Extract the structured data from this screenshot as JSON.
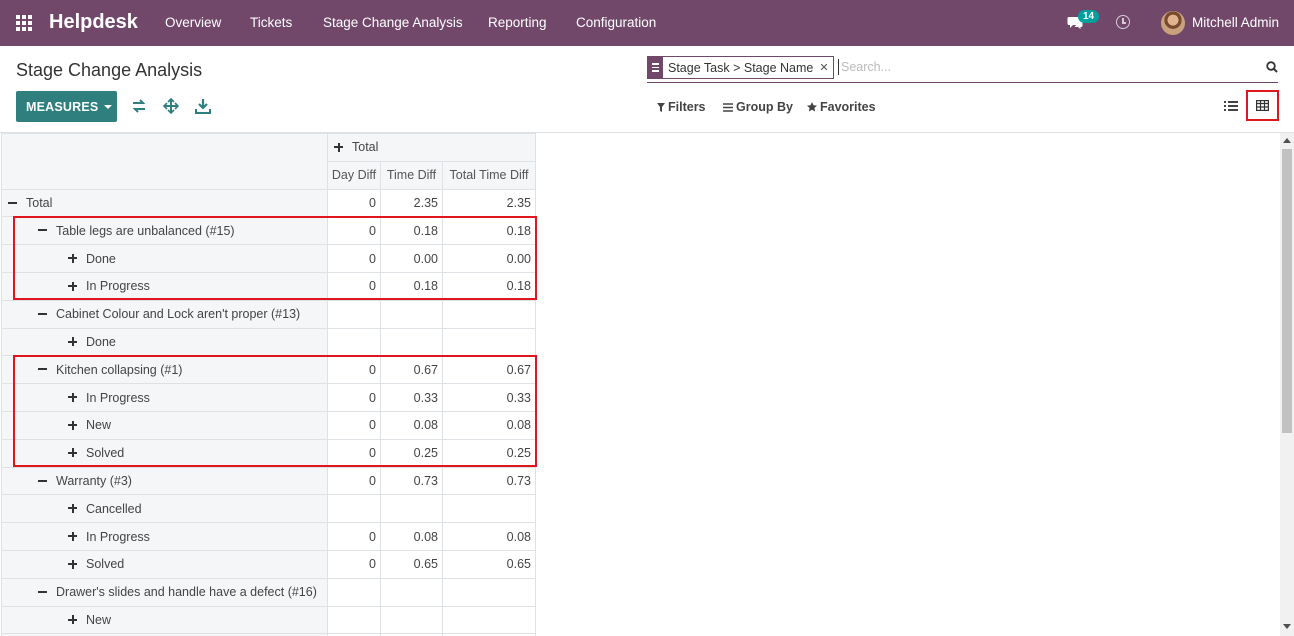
{
  "nav": {
    "brand": "Helpdesk",
    "menu": [
      "Overview",
      "Tickets",
      "Stage Change Analysis",
      "Reporting",
      "Configuration"
    ],
    "chat_badge": "14",
    "user": "Mitchell Admin"
  },
  "control": {
    "title": "Stage Change Analysis",
    "measures_label": "MEASURES",
    "facet_label": "Stage Task > Stage Name",
    "search_placeholder": "Search...",
    "filters_label": "Filters",
    "groupby_label": "Group By",
    "favorites_label": "Favorites"
  },
  "pivot": {
    "col_total": "Total",
    "measures": [
      "Day Diff",
      "Time Diff",
      "Total Time Diff"
    ],
    "rows": [
      {
        "label": "Total",
        "level": 0,
        "icon": "minus",
        "v": [
          "0",
          "2.35",
          "2.35"
        ]
      },
      {
        "label": "Table legs are unbalanced (#15)",
        "level": 1,
        "icon": "minus",
        "v": [
          "0",
          "0.18",
          "0.18"
        ]
      },
      {
        "label": "Done",
        "level": 2,
        "icon": "plus",
        "v": [
          "0",
          "0.00",
          "0.00"
        ]
      },
      {
        "label": "In Progress",
        "level": 2,
        "icon": "plus",
        "v": [
          "0",
          "0.18",
          "0.18"
        ]
      },
      {
        "label": "Cabinet Colour and Lock aren't proper (#13)",
        "level": 1,
        "icon": "minus",
        "v": [
          "",
          "",
          ""
        ]
      },
      {
        "label": "Done",
        "level": 2,
        "icon": "plus",
        "v": [
          "",
          "",
          ""
        ]
      },
      {
        "label": "Kitchen collapsing (#1)",
        "level": 1,
        "icon": "minus",
        "v": [
          "0",
          "0.67",
          "0.67"
        ]
      },
      {
        "label": "In Progress",
        "level": 2,
        "icon": "plus",
        "v": [
          "0",
          "0.33",
          "0.33"
        ]
      },
      {
        "label": "New",
        "level": 2,
        "icon": "plus",
        "v": [
          "0",
          "0.08",
          "0.08"
        ]
      },
      {
        "label": "Solved",
        "level": 2,
        "icon": "plus",
        "v": [
          "0",
          "0.25",
          "0.25"
        ]
      },
      {
        "label": "Warranty (#3)",
        "level": 1,
        "icon": "minus",
        "v": [
          "0",
          "0.73",
          "0.73"
        ]
      },
      {
        "label": "Cancelled",
        "level": 2,
        "icon": "plus",
        "v": [
          "",
          "",
          ""
        ]
      },
      {
        "label": "In Progress",
        "level": 2,
        "icon": "plus",
        "v": [
          "0",
          "0.08",
          "0.08"
        ]
      },
      {
        "label": "Solved",
        "level": 2,
        "icon": "plus",
        "v": [
          "0",
          "0.65",
          "0.65"
        ]
      },
      {
        "label": "Drawer's slides and handle have a defect (#16)",
        "level": 1,
        "icon": "minus",
        "v": [
          "",
          "",
          ""
        ]
      },
      {
        "label": "New",
        "level": 2,
        "icon": "plus",
        "v": [
          "",
          "",
          ""
        ]
      },
      {
        "label": "",
        "level": 1,
        "icon": "none",
        "v": [
          "",
          "",
          ""
        ]
      }
    ]
  },
  "colors": {
    "nav": "#71486a",
    "primary": "#2f7f7e",
    "highlight": "#e0161f"
  }
}
